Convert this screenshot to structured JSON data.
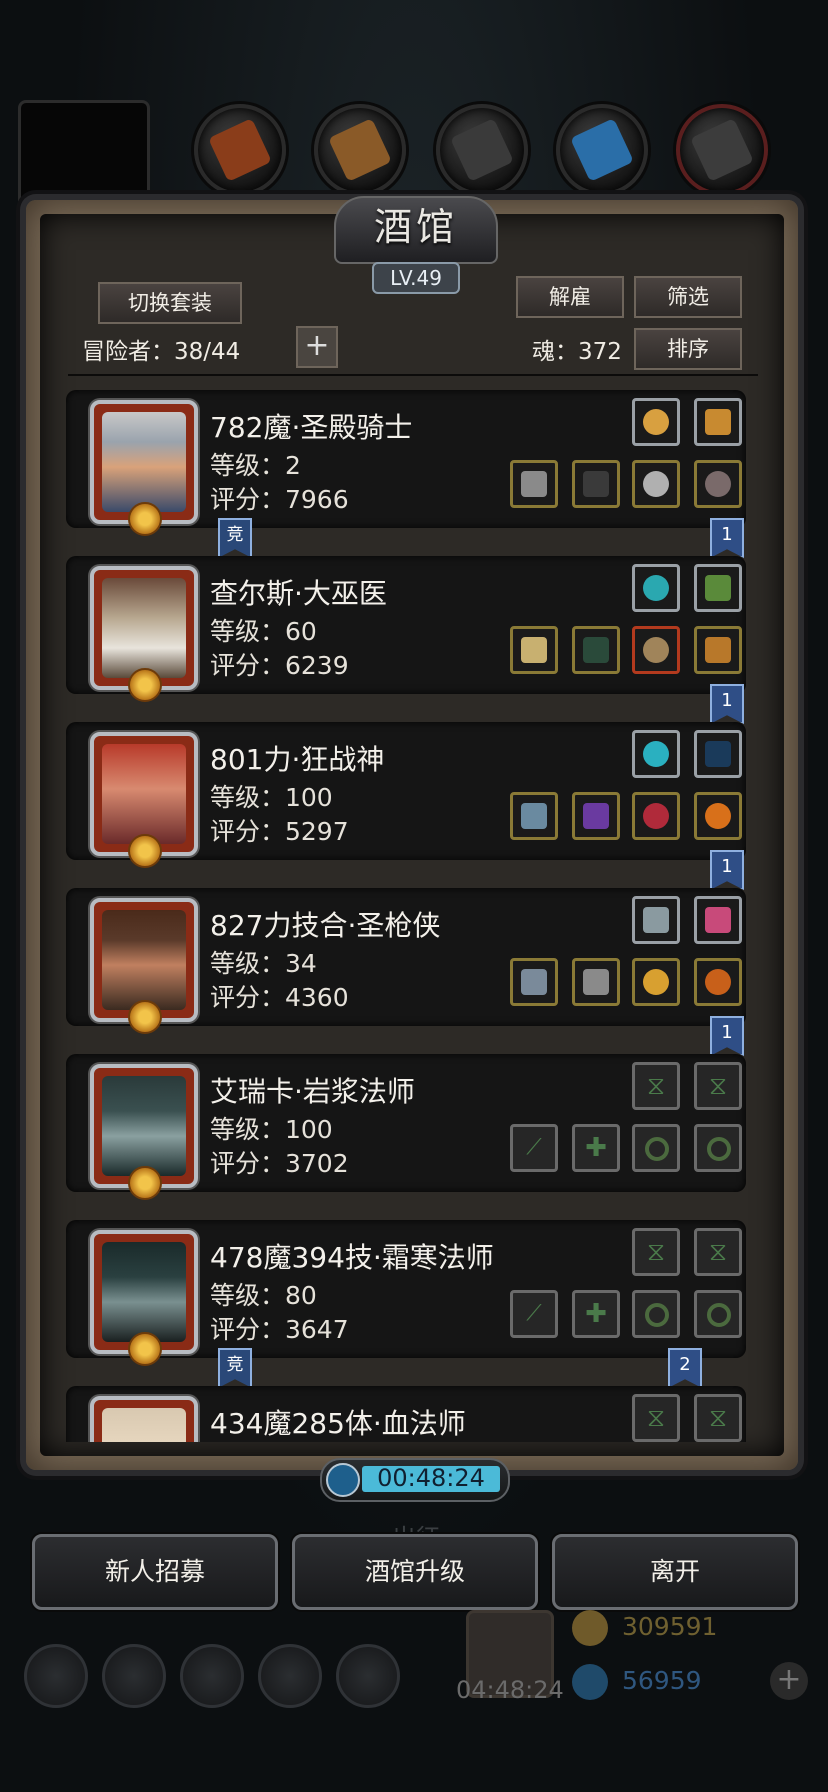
{
  "tavern": {
    "title": "酒馆",
    "level": "LV.49",
    "switch_outfit": "切换套装",
    "dismiss": "解雇",
    "filter": "筛选",
    "sort": "排序",
    "adventurers_label": "冒险者：38/44",
    "soul_label": "魂：372",
    "add": "+"
  },
  "heroes": [
    {
      "name": "782魔·圣殿骑士",
      "level": "等级：2",
      "score": "评分：7966",
      "tag_left": "竞",
      "tag_right": "1"
    },
    {
      "name": "查尔斯·大巫医",
      "level": "等级：60",
      "score": "评分：6239",
      "tag_right": "1"
    },
    {
      "name": "801力·狂战神",
      "level": "等级：100",
      "score": "评分：5297",
      "tag_right": "1"
    },
    {
      "name": "827力技合·圣枪侠",
      "level": "等级：34",
      "score": "评分：4360",
      "tag_right": "1"
    },
    {
      "name": "艾瑞卡·岩浆法师",
      "level": "等级：100",
      "score": "评分：3702"
    },
    {
      "name": "478魔394技·霜寒法师",
      "level": "等级：80",
      "score": "评分：3647",
      "tag_left": "竞",
      "tag_right": "2"
    },
    {
      "name": "434魔285体·血法师"
    }
  ],
  "timer": "00:48:24",
  "buttons": {
    "recruit": "新人招募",
    "upgrade": "酒馆升级",
    "leave": "离开"
  },
  "footer": {
    "gift_timer": "04:48:24",
    "gold": "309591",
    "gems": "56959",
    "plus": "+",
    "behind_text": "出征"
  },
  "colors": {
    "accent_gold": "#f2c44a",
    "ribbon_blue": "#2f4e86",
    "timer_cyan": "#4bbad8"
  },
  "icons": [
    "dragon-portrait-icon",
    "meat-resource-icon",
    "wood-resource-icon",
    "iron-resource-icon",
    "crystal-resource-icon",
    "stone-resource-icon"
  ]
}
